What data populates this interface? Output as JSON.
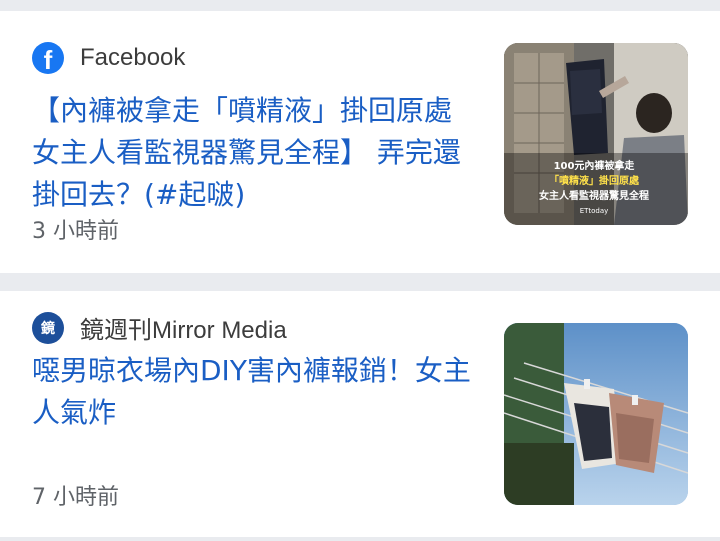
{
  "articles": [
    {
      "source": "Facebook",
      "source_icon": "facebook-icon",
      "title": "【內褲被拿走「噴精液」掛回原處 女主人看監視器驚見全程】 弄完還掛回去？(#起啵)",
      "time": "3 小時前",
      "thumbnail_caption": [
        "100元內褲被拿走",
        "「噴精液」掛回原處",
        "女主人看監視器驚見全程",
        "ETtoday"
      ]
    },
    {
      "source": "鏡週刊Mirror Media",
      "source_icon": "mirror-media-icon",
      "source_icon_text": "鏡",
      "title": "噁男晾衣場內DIY害內褲報銷！女主人氣炸",
      "time": "7 小時前"
    }
  ],
  "colors": {
    "headline": "#1a5ec4",
    "background": "#e9ebef",
    "facebook_brand": "#1877f2"
  }
}
